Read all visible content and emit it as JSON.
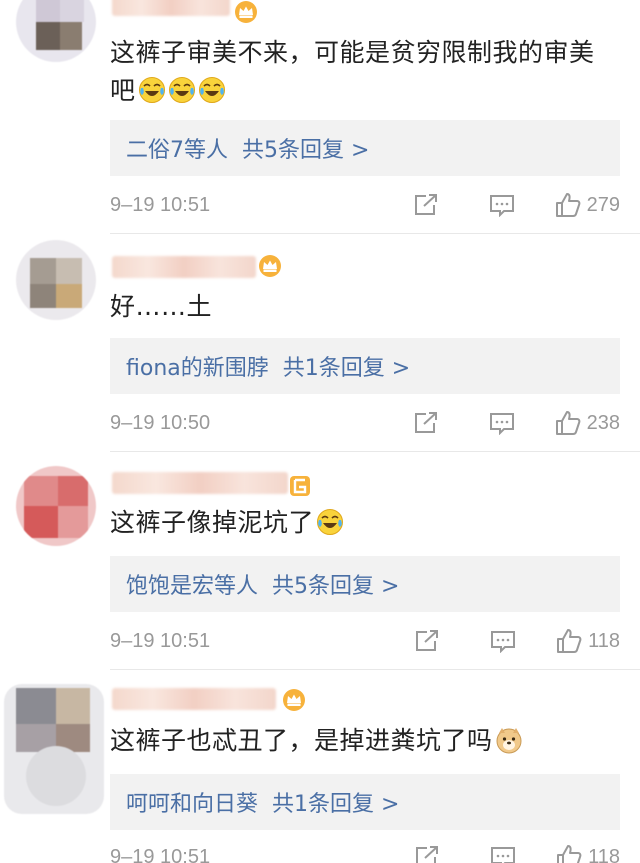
{
  "comments": [
    {
      "text": "这裤子审美不来，可能是贫穷限制我的审美吧",
      "emojis": [
        "laugh-cry",
        "laugh-cry",
        "laugh-cry"
      ],
      "reply": {
        "who": "二俗7等人",
        "summary": "共5条回复 >"
      },
      "time": "9–19 10:51",
      "likes": "279"
    },
    {
      "text": "好……土",
      "emojis": [],
      "reply": {
        "who": "fiona的新围脖",
        "summary": "共1条回复 >"
      },
      "time": "9–19 10:50",
      "likes": "238"
    },
    {
      "text": "这裤子像掉泥坑了",
      "emojis": [
        "laugh-cry"
      ],
      "reply": {
        "who": "饱饱是宏等人",
        "summary": "共5条回复 >"
      },
      "time": "9–19 10:51",
      "likes": "118"
    },
    {
      "text": "这裤子也忒丑了，是掉进粪坑了吗",
      "emojis": [
        "doge"
      ],
      "reply": {
        "who": "呵呵和向日葵",
        "summary": "共1条回复 >"
      },
      "time": "9–19 10:51",
      "likes": "118"
    }
  ],
  "colors": {
    "link": "#4a6fa5",
    "meta": "#999999",
    "reply_bg": "#f2f2f2"
  }
}
